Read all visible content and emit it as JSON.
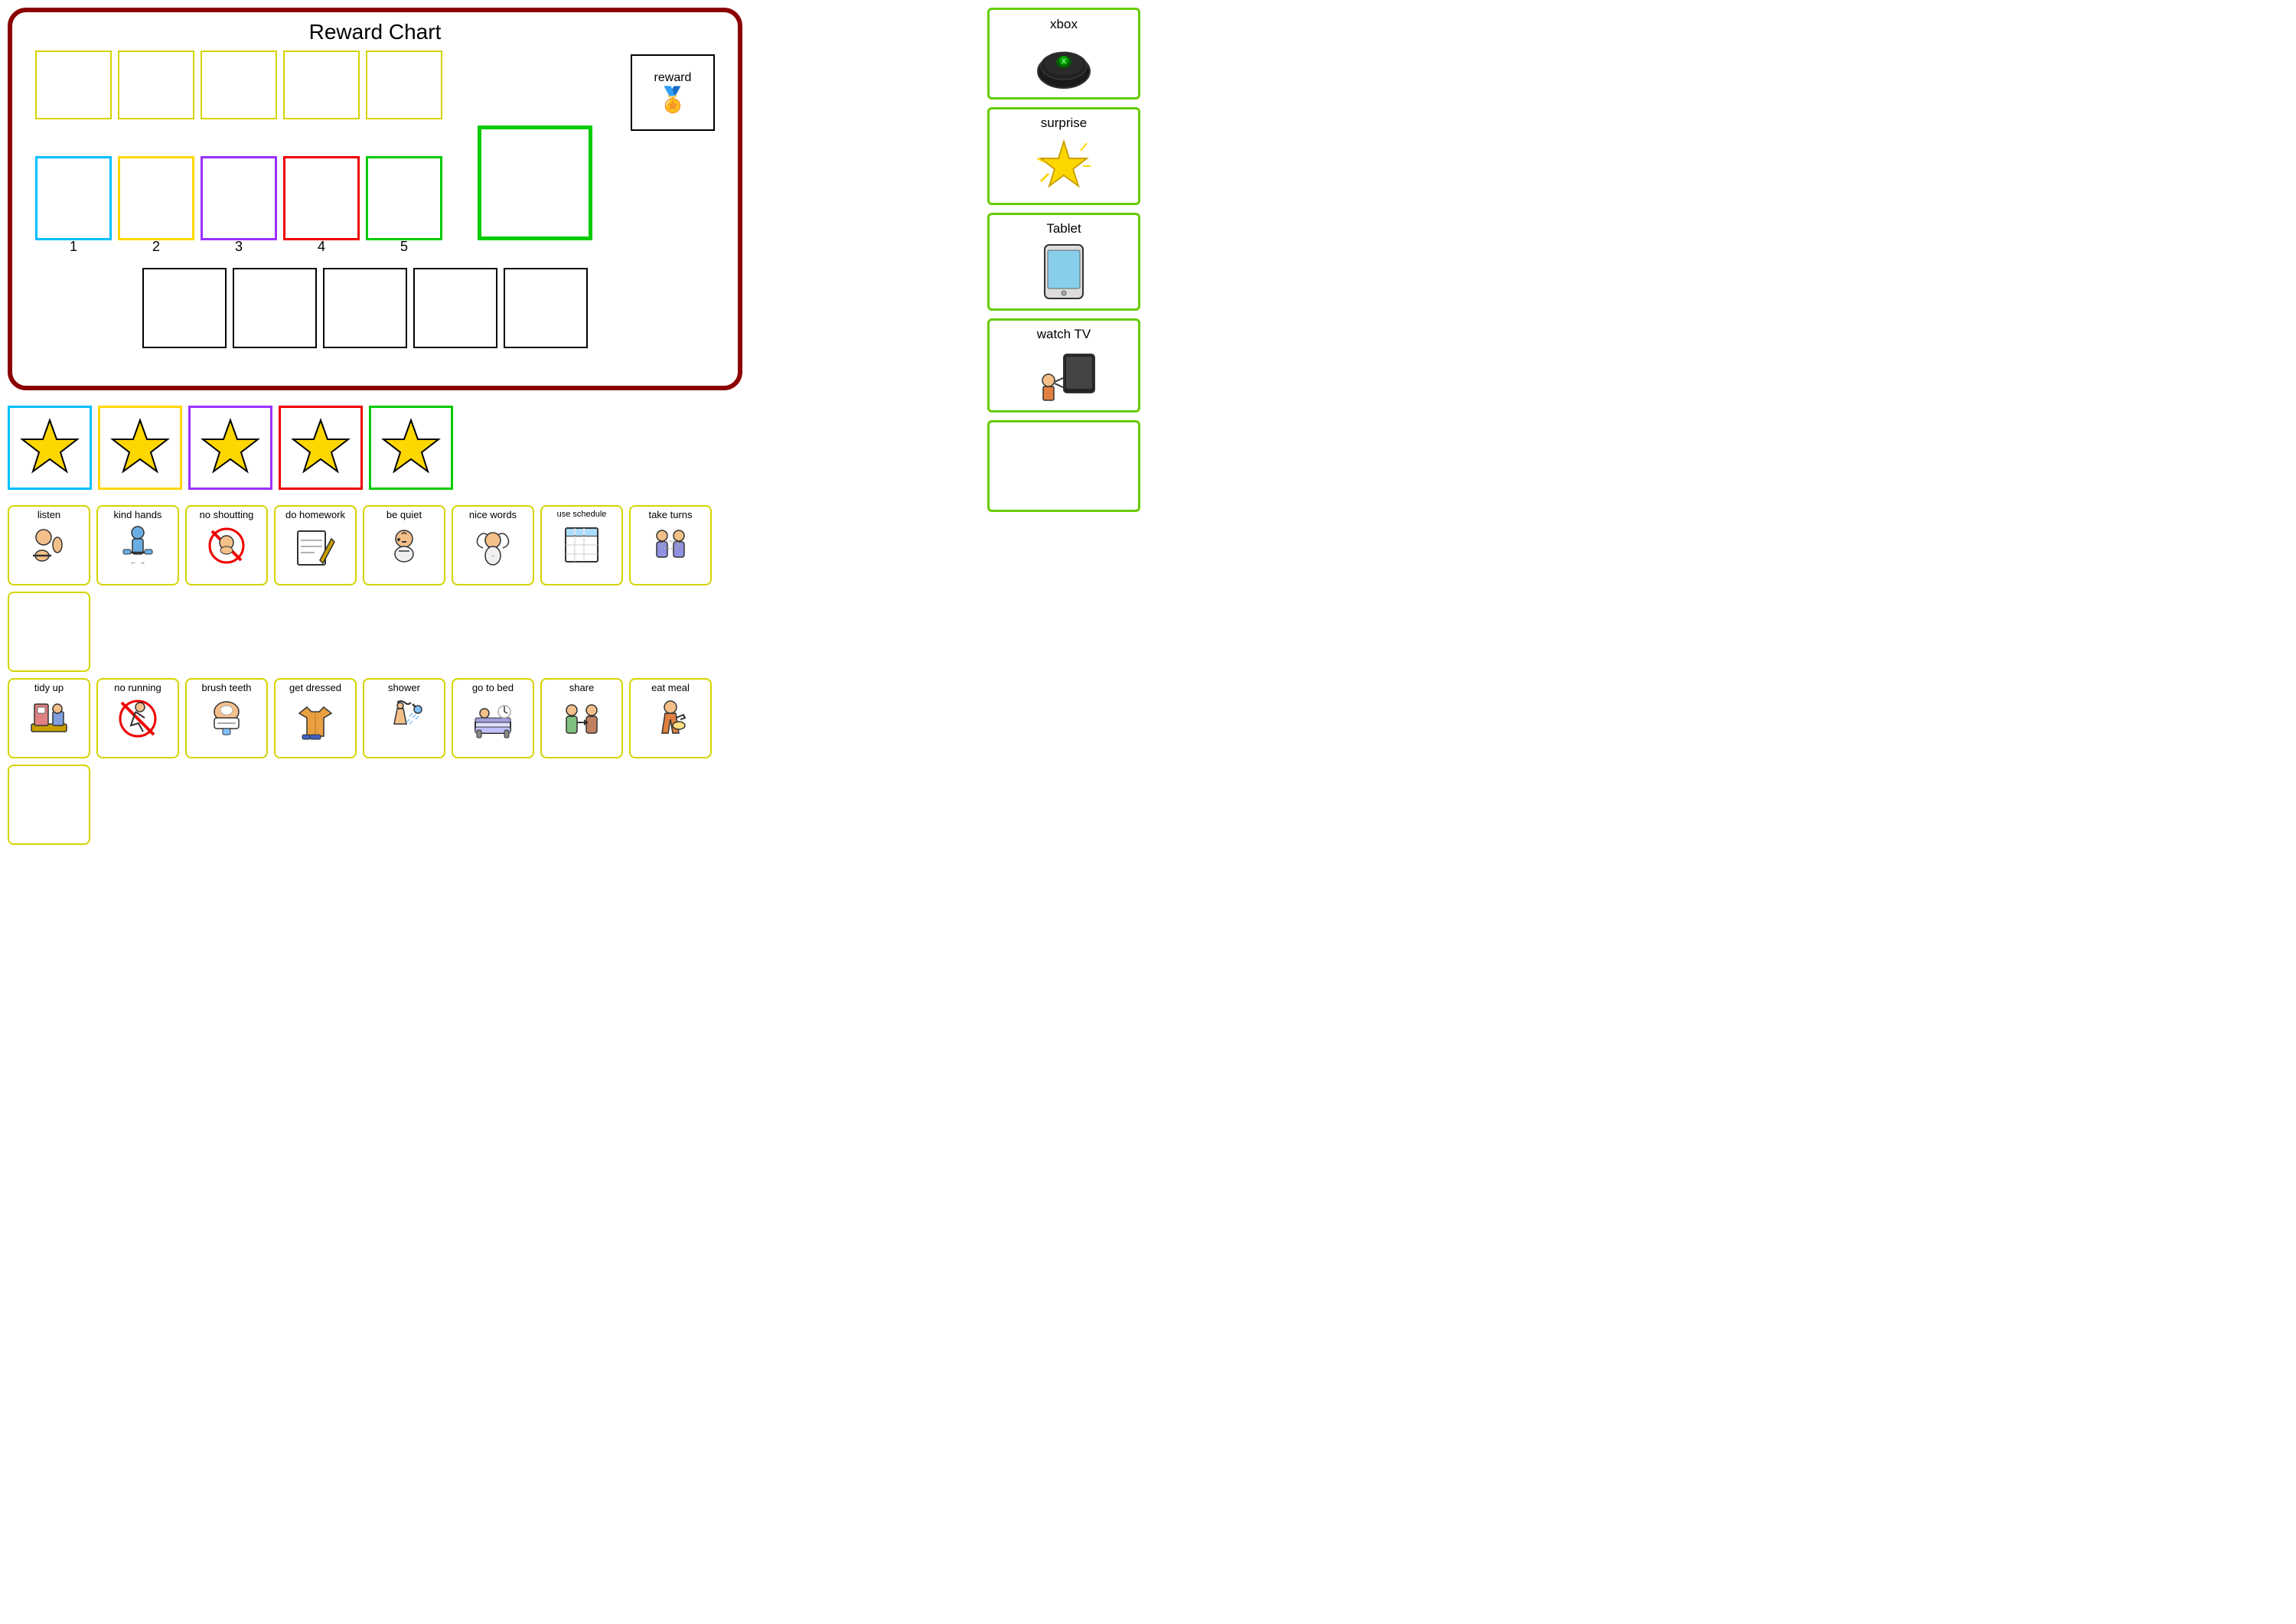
{
  "chart": {
    "title": "Reward Chart",
    "reward_label": "reward",
    "top_row_count": 5,
    "colored_boxes": [
      {
        "num": "1",
        "border": "cyan"
      },
      {
        "num": "2",
        "border": "yellow"
      },
      {
        "num": "3",
        "border": "purple"
      },
      {
        "num": "4",
        "border": "red"
      },
      {
        "num": "5",
        "border": "green"
      }
    ],
    "bottom_boxes_count": 5
  },
  "stars": [
    {
      "border": "cyan"
    },
    {
      "border": "yellow"
    },
    {
      "border": "purple"
    },
    {
      "border": "red"
    },
    {
      "border": "green"
    }
  ],
  "behavior_cards_row1": [
    {
      "label": "listen",
      "icon": "👂"
    },
    {
      "label": "kind hands",
      "icon": "🤲"
    },
    {
      "label": "no shoutting",
      "icon": "🔇"
    },
    {
      "label": "do homework",
      "icon": "📚"
    },
    {
      "label": "be quiet",
      "icon": "🤫"
    },
    {
      "label": "nice words",
      "icon": "💬"
    },
    {
      "label": "use schedule",
      "icon": "📅"
    },
    {
      "label": "take turns",
      "icon": "👥"
    },
    {
      "label": "",
      "icon": ""
    }
  ],
  "behavior_cards_row2": [
    {
      "label": "tidy up",
      "icon": "🧹"
    },
    {
      "label": "no running",
      "icon": "🚫"
    },
    {
      "label": "brush teeth",
      "icon": "🦷"
    },
    {
      "label": "get dressed",
      "icon": "👕"
    },
    {
      "label": "shower",
      "icon": "🚿"
    },
    {
      "label": "go to bed",
      "icon": "🛏️"
    },
    {
      "label": "share",
      "icon": "🤝"
    },
    {
      "label": "eat meal",
      "icon": "🍽️"
    },
    {
      "label": "",
      "icon": ""
    }
  ],
  "rewards": [
    {
      "label": "xbox",
      "icon": "🎮"
    },
    {
      "label": "surprise",
      "icon": "⭐"
    },
    {
      "label": "Tablet",
      "icon": "📱"
    },
    {
      "label": "watch TV",
      "icon": "📺"
    },
    {
      "label": "",
      "icon": ""
    }
  ]
}
